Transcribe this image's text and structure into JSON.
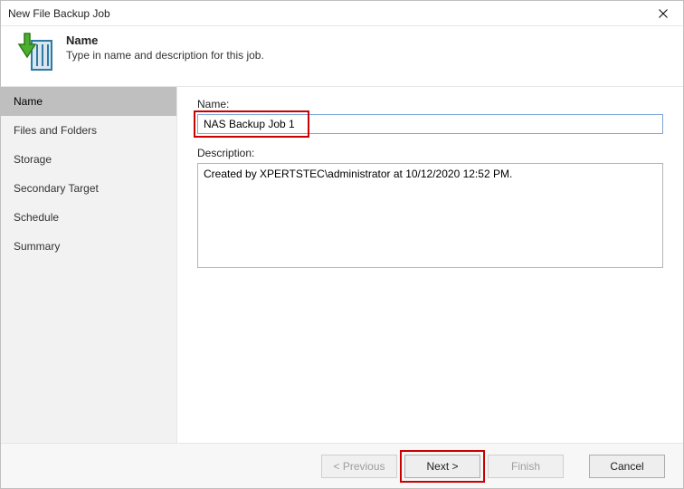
{
  "window": {
    "title": "New File Backup Job"
  },
  "header": {
    "title": "Name",
    "subtitle": "Type in name and description for this job."
  },
  "sidebar": {
    "steps": [
      {
        "label": "Name",
        "active": true
      },
      {
        "label": "Files and Folders",
        "active": false
      },
      {
        "label": "Storage",
        "active": false
      },
      {
        "label": "Secondary Target",
        "active": false
      },
      {
        "label": "Schedule",
        "active": false
      },
      {
        "label": "Summary",
        "active": false
      }
    ]
  },
  "form": {
    "name_label": "Name:",
    "name_value": "NAS Backup Job 1",
    "description_label": "Description:",
    "description_value": "Created by XPERTSTEC\\administrator at 10/12/2020 12:52 PM."
  },
  "footer": {
    "previous_label": "< Previous",
    "next_label": "Next >",
    "finish_label": "Finish",
    "cancel_label": "Cancel",
    "previous_enabled": false,
    "finish_enabled": false
  }
}
